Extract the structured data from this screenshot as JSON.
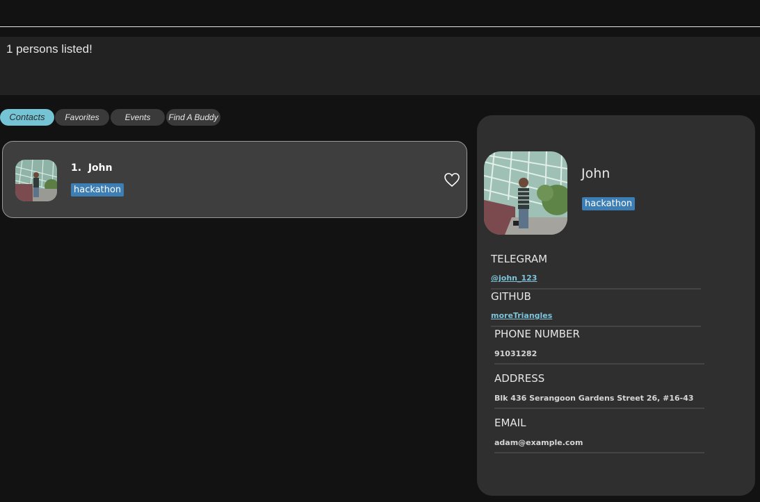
{
  "result": {
    "message": "1 persons listed!"
  },
  "tabs": [
    {
      "label": "Contacts",
      "active": true
    },
    {
      "label": "Favorites",
      "active": false
    },
    {
      "label": "Events",
      "active": false
    },
    {
      "label": "Find A Buddy",
      "active": false
    }
  ],
  "list": {
    "items": [
      {
        "index": "1.",
        "name": "John",
        "tag": "hackathon"
      }
    ]
  },
  "detail": {
    "name": "John",
    "tag": "hackathon",
    "telegram_label": "TELEGRAM",
    "telegram_value": "@john_123",
    "github_label": "GITHUB",
    "github_value": "moreTriangles",
    "phone_label": "PHONE NUMBER",
    "phone_value": "91031282",
    "address_label": "ADDRESS",
    "address_value": "Blk 436 Serangoon Gardens Street 26, #16-43",
    "email_label": "EMAIL",
    "email_value": "adam@example.com"
  },
  "colors": {
    "accent": "#74c4d6",
    "tag": "#3d7fb5",
    "panel": "#2f2f2f",
    "card": "#3e3e3e"
  }
}
